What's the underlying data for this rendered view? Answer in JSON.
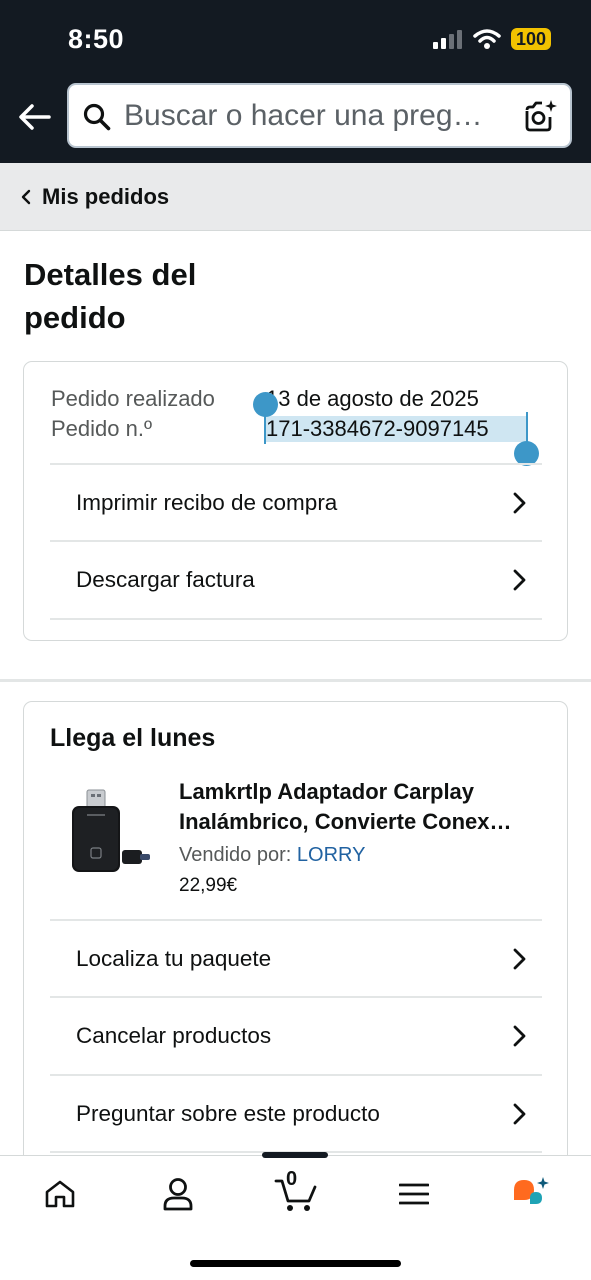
{
  "status": {
    "time": "8:50",
    "battery": "100"
  },
  "search": {
    "placeholder": "Buscar o hacer una preg…"
  },
  "breadcrumb": {
    "label": "Mis pedidos"
  },
  "page": {
    "title": "Detalles del pedido"
  },
  "order": {
    "placed_label": "Pedido realizado",
    "placed_value": "13 de agosto de 2025",
    "number_label": "Pedido n.º",
    "number_value": "171-3384672-9097145",
    "actions": [
      {
        "label": "Imprimir recibo de compra"
      },
      {
        "label": "Descargar factura"
      }
    ]
  },
  "shipment": {
    "heading": "Llega el lunes",
    "product": {
      "title_line1": "Lamkrtlp Adaptador Carplay",
      "title_line2": "Inalámbrico, Convierte Conex…",
      "seller_label": "Vendido por:",
      "seller_name": "LORRY",
      "price": "22,99€"
    },
    "actions": [
      {
        "label": "Localiza tu paquete"
      },
      {
        "label": "Cancelar productos"
      },
      {
        "label": "Preguntar sobre este producto"
      }
    ]
  },
  "tabbar": {
    "cart_count": "0"
  },
  "colors": {
    "header_bg": "#131a22",
    "link": "#2162a1",
    "selection": "#3d97c8",
    "battery": "#f2c200"
  }
}
